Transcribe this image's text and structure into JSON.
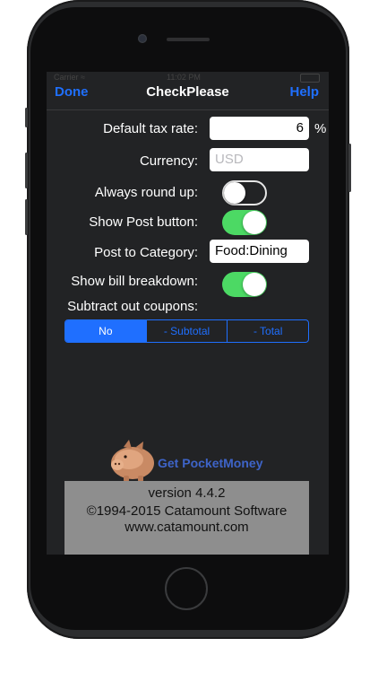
{
  "status": {
    "carrier": "Carrier ≈",
    "time": "11:02 PM"
  },
  "nav": {
    "left": "Done",
    "title": "CheckPlease",
    "right": "Help"
  },
  "settings": {
    "tax_label": "Default tax rate:",
    "tax_value": "6",
    "tax_unit": "%",
    "currency_label": "Currency:",
    "currency_placeholder": "USD",
    "round_label": "Always round up:",
    "round_on": false,
    "post_button_label": "Show Post button:",
    "post_button_on": true,
    "category_label": "Post to Category:",
    "category_value": "Food:Dining",
    "breakdown_label": "Show bill breakdown:",
    "breakdown_on": true,
    "coupons_label": "Subtract out coupons:",
    "coupon_options": [
      "No",
      "- Subtotal",
      "- Total"
    ],
    "coupon_selected": "No"
  },
  "promo": {
    "link": "Get PocketMoney"
  },
  "footer": {
    "version": "version 4.4.2",
    "copyright": "©1994-2015 Catamount Software",
    "website": "www.catamount.com"
  },
  "colors": {
    "accent": "#1f6fff",
    "toggle_on": "#4cd964",
    "background": "#222325"
  }
}
